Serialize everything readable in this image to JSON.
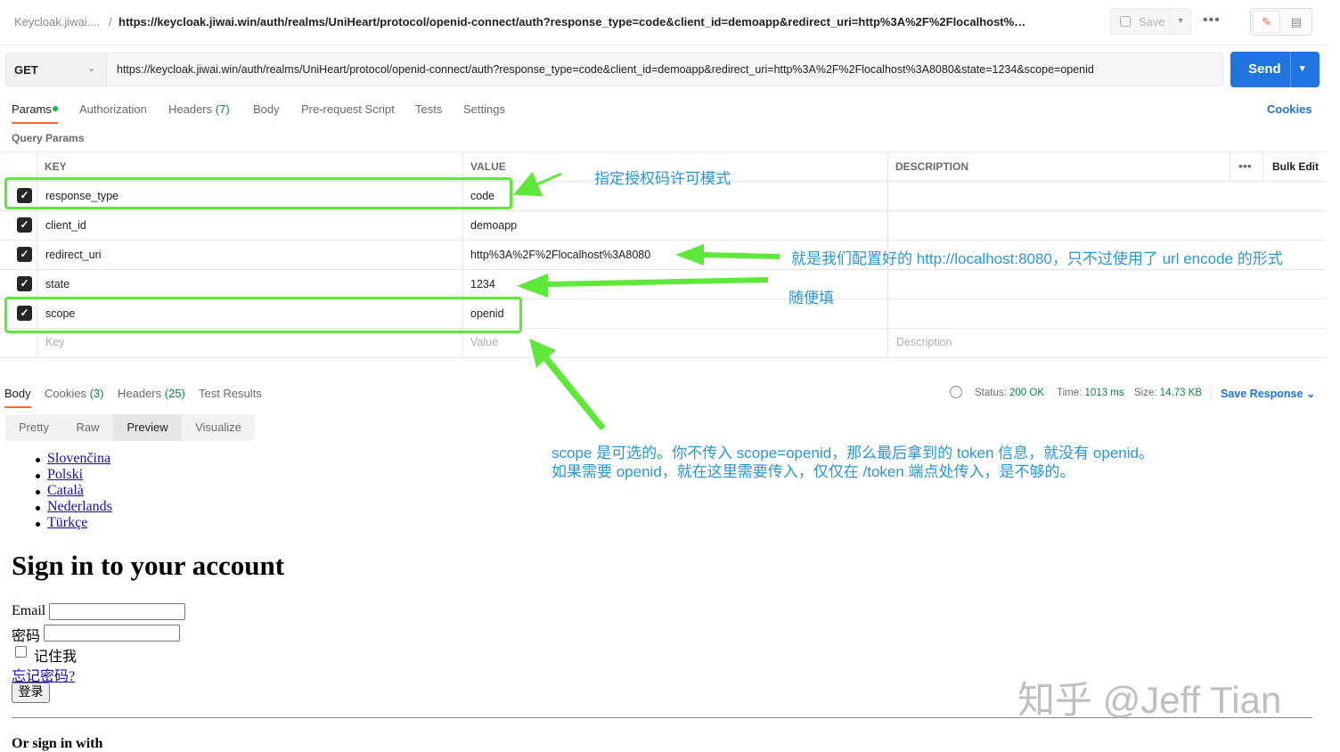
{
  "topbar": {
    "breadcrumb_parent": "Keycloak.jiwai....",
    "separator": "/",
    "request_title": "https://keycloak.jiwai.win/auth/realms/UniHeart/protocol/openid-connect/auth?response_type=code&client_id=demoapp&redirect_uri=http%3A%2F%2Flocalhost%3A8080&...",
    "save_label": "Save",
    "more": "•••"
  },
  "request": {
    "method": "GET",
    "url": "https://keycloak.jiwai.win/auth/realms/UniHeart/protocol/openid-connect/auth?response_type=code&client_id=demoapp&redirect_uri=http%3A%2F%2Flocalhost%3A8080&state=1234&scope=openid",
    "send_label": "Send"
  },
  "tabs": [
    {
      "label": "Params",
      "count": ""
    },
    {
      "label": "Authorization",
      "count": ""
    },
    {
      "label": "Headers",
      "count": "(7)"
    },
    {
      "label": "Body",
      "count": ""
    },
    {
      "label": "Pre-request Script",
      "count": ""
    },
    {
      "label": "Tests",
      "count": ""
    },
    {
      "label": "Settings",
      "count": ""
    }
  ],
  "cookies_link": "Cookies",
  "query_params": {
    "title": "Query Params",
    "headers": {
      "key": "KEY",
      "value": "VALUE",
      "description": "DESCRIPTION",
      "more": "•••",
      "bulk_edit": "Bulk Edit"
    },
    "rows": [
      {
        "checked": true,
        "key": "response_type",
        "value": "code",
        "description": ""
      },
      {
        "checked": true,
        "key": "client_id",
        "value": "demoapp",
        "description": ""
      },
      {
        "checked": true,
        "key": "redirect_uri",
        "value": "http%3A%2F%2Flocalhost%3A8080",
        "description": ""
      },
      {
        "checked": true,
        "key": "state",
        "value": "1234",
        "description": ""
      },
      {
        "checked": true,
        "key": "scope",
        "value": "openid",
        "description": ""
      }
    ],
    "placeholders": {
      "key": "Key",
      "value": "Value",
      "description": "Description"
    }
  },
  "response": {
    "tabs": [
      {
        "label": "Body",
        "count": ""
      },
      {
        "label": "Cookies",
        "count": "(3)"
      },
      {
        "label": "Headers",
        "count": "(25)"
      },
      {
        "label": "Test Results",
        "count": ""
      }
    ],
    "status_label": "Status:",
    "status_value": "200 OK",
    "time_label": "Time:",
    "time_value": "1013 ms",
    "size_label": "Size:",
    "size_value": "14.73 KB",
    "save_response": "Save Response",
    "view_modes": [
      "Pretty",
      "Raw",
      "Preview",
      "Visualize"
    ],
    "active_view": "Preview"
  },
  "preview": {
    "languages": [
      "Slovenčina",
      "Polski",
      "Català",
      "Nederlands",
      "Türkçe"
    ],
    "heading": "Sign in to your account",
    "email_label": "Email",
    "password_label": "密码",
    "remember_label": "记住我",
    "forgot_link": "忘记密码?",
    "login_button": "登录",
    "or_sign_in": "Or sign in with"
  },
  "annotations": {
    "response_type_note": "指定授权码许可模式",
    "redirect_note": "就是我们配置好的 http://localhost:8080，只不过使用了 url encode 的形式",
    "state_note": "随便填",
    "scope_note_line1": "scope 是可选的。你不传入 scope=openid，那么最后拿到的 token 信息，就没有 openid。",
    "scope_note_line2": "如果需要 openid，就在这里需要传入，仅仅在 /token 端点处传入，是不够的。",
    "arrow_color": "#5ee83a",
    "note_color": "#2a96d6"
  },
  "watermark": "知乎 @Jeff Tian"
}
